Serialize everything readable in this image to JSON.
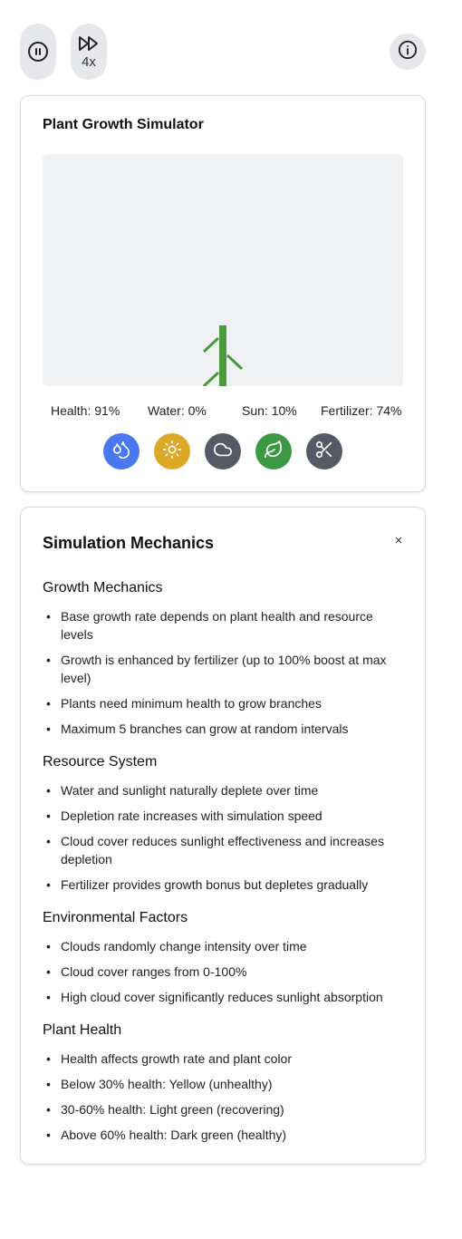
{
  "controls": {
    "pause_icon": "pause-icon",
    "speed_icon": "fast-forward-icon",
    "speed_label": "4x",
    "info_icon": "info-icon"
  },
  "simulator": {
    "title": "Plant Growth Simulator",
    "stats": {
      "health": "Health: 91%",
      "water": "Water: 0%",
      "sun": "Sun: 10%",
      "fertilizer": "Fertilizer: 74%"
    },
    "actions": [
      {
        "name": "water",
        "icon": "water-drops-icon",
        "color": "#4a78ee"
      },
      {
        "name": "sun",
        "icon": "sun-icon",
        "color": "#dba828"
      },
      {
        "name": "cloud",
        "icon": "cloud-icon",
        "color": "#555a66"
      },
      {
        "name": "fertilizer",
        "icon": "leaf-icon",
        "color": "#3b9944"
      },
      {
        "name": "prune",
        "icon": "scissors-icon",
        "color": "#555a66"
      }
    ],
    "plant_color": "#4a9a3c",
    "canvas_color": "#f0f1f3"
  },
  "mechanics": {
    "title": "Simulation Mechanics",
    "close_label": "×",
    "sections": [
      {
        "heading": "Growth Mechanics",
        "items": [
          "Base growth rate depends on plant health and resource levels",
          "Growth is enhanced by fertilizer (up to 100% boost at max level)",
          "Plants need minimum health to grow branches",
          "Maximum 5 branches can grow at random intervals"
        ]
      },
      {
        "heading": "Resource System",
        "items": [
          "Water and sunlight naturally deplete over time",
          "Depletion rate increases with simulation speed",
          "Cloud cover reduces sunlight effectiveness and increases depletion",
          "Fertilizer provides growth bonus but depletes gradually"
        ]
      },
      {
        "heading": "Environmental Factors",
        "items": [
          "Clouds randomly change intensity over time",
          "Cloud cover ranges from 0-100%",
          "High cloud cover significantly reduces sunlight absorption"
        ]
      },
      {
        "heading": "Plant Health",
        "items": [
          "Health affects growth rate and plant color",
          "Below 30% health: Yellow (unhealthy)",
          "30-60% health: Light green (recovering)",
          "Above 60% health: Dark green (healthy)"
        ]
      }
    ]
  }
}
